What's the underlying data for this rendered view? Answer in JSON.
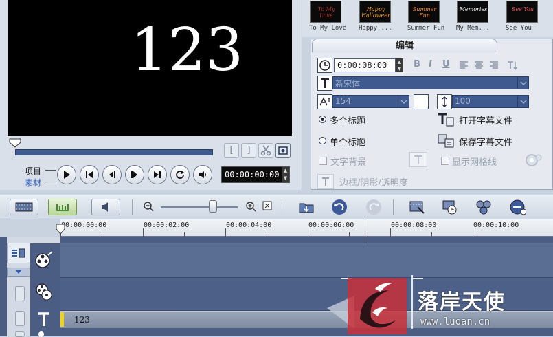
{
  "preview": {
    "overlay_text": "123",
    "label_project": "项目",
    "label_clip": "素材",
    "timecode": "00:00:00:00",
    "trim_start": "[",
    "trim_end": "]"
  },
  "library": {
    "thumbs": [
      {
        "label": "To My Love",
        "caption": "To My Love",
        "color": "#b9342a"
      },
      {
        "label": "Happy ...",
        "caption": "Happy Halloween",
        "color": "#f0a020"
      },
      {
        "label": "Summer Fun",
        "caption": "Summer Fun",
        "color": "#ff8a1a"
      },
      {
        "label": "My Mem...",
        "caption": "Memories",
        "color": "#ffffff"
      },
      {
        "label": "See You",
        "caption": "See You",
        "color": "#ff4f5a"
      }
    ]
  },
  "edit": {
    "tab_label": "编辑",
    "duration": "0:00:08:00",
    "font_name": "新宋体",
    "font_size": "154",
    "line_spacing": "100",
    "radio_multi": "多个标题",
    "radio_single": "单个标题",
    "open_subtitle": "打开字幕文件",
    "save_subtitle": "保存字幕文件",
    "text_background": "文字背景",
    "show_grid": "显示网格线",
    "border_shadow": "边框/阴影/透明度",
    "bold": "B",
    "italic": "I",
    "underline": "U"
  },
  "timeline": {
    "ticks": [
      "00:00:00:00",
      "00:00:02:00",
      "00:00:04:00",
      "00:00:06:00",
      "00:00:08:00",
      "00:00:10:00"
    ],
    "title_clip_text": "123"
  },
  "watermark": {
    "text": "落岸天使",
    "url": "www.luoan.cn"
  },
  "colors": {
    "accent": "#3f5a8e",
    "preview_bg": "#000000",
    "timeline_bg": "#4b5d82",
    "clip_marker": "#f2d21e"
  }
}
